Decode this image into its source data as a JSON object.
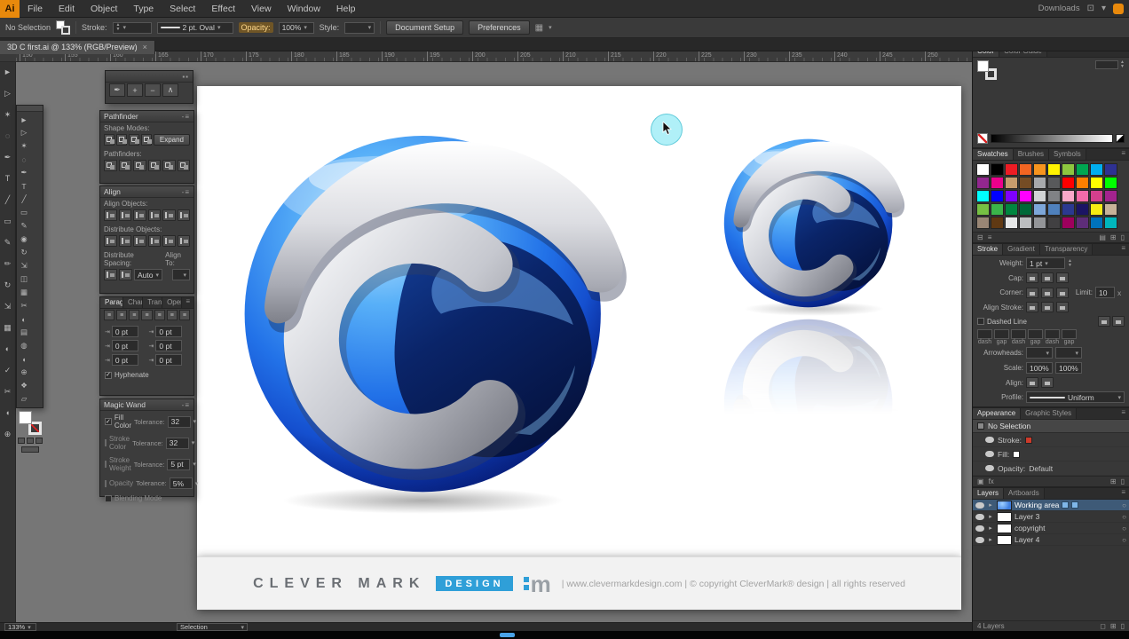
{
  "menubar": {
    "logo": "Ai",
    "items": [
      "File",
      "Edit",
      "Object",
      "Type",
      "Select",
      "Effect",
      "View",
      "Window",
      "Help"
    ],
    "right_label": "Downloads"
  },
  "controlbar": {
    "selection": "No Selection",
    "stroke_label": "Stroke:",
    "brush_value": "2 pt. Oval",
    "opacity_label": "Opacity:",
    "opacity_value": "100%",
    "style_label": "Style:",
    "document_setup": "Document Setup",
    "preferences": "Preferences"
  },
  "tab": {
    "title": "3D C first.ai @ 133% (RGB/Preview)",
    "close": "×"
  },
  "ruler": {
    "numbers": [
      "150",
      "155",
      "160",
      "165",
      "170",
      "175",
      "180",
      "185",
      "190",
      "195",
      "200",
      "205",
      "210",
      "215",
      "220",
      "225",
      "230",
      "235",
      "240",
      "245",
      "250"
    ]
  },
  "toolstrip": {
    "tools": [
      {
        "n": "selection",
        "g": "►"
      },
      {
        "n": "direct-selection",
        "g": "▷"
      },
      {
        "n": "magic-wand",
        "g": "✶"
      },
      {
        "n": "lasso",
        "g": "◌"
      },
      {
        "n": "pen",
        "g": "✒"
      },
      {
        "n": "type",
        "g": "T"
      },
      {
        "n": "line-segment",
        "g": "╱"
      },
      {
        "n": "rectangle",
        "g": "▭"
      },
      {
        "n": "paintbrush",
        "g": "✎"
      },
      {
        "n": "pencil",
        "g": "✏"
      },
      {
        "n": "rotate",
        "g": "↻"
      },
      {
        "n": "scale",
        "g": "⇲"
      },
      {
        "n": "mesh",
        "g": "▦"
      },
      {
        "n": "gradient",
        "g": "◐"
      },
      {
        "n": "eyedropper",
        "g": "✓"
      },
      {
        "n": "scissors",
        "g": "✂"
      },
      {
        "n": "hand",
        "g": "◖"
      },
      {
        "n": "zoom",
        "g": "⊕"
      }
    ]
  },
  "toolbox": {
    "tools": [
      {
        "n": "selection",
        "g": "►"
      },
      {
        "n": "direct-selection",
        "g": "▷"
      },
      {
        "n": "magic-wand",
        "g": "✶"
      },
      {
        "n": "lasso",
        "g": "◌"
      },
      {
        "n": "pen",
        "g": "✒"
      },
      {
        "n": "type",
        "g": "T"
      },
      {
        "n": "line-segment",
        "g": "╱"
      },
      {
        "n": "rectangle",
        "g": "▭"
      },
      {
        "n": "paintbrush",
        "g": "✎"
      },
      {
        "n": "blob-brush",
        "g": "◉"
      },
      {
        "n": "rotate",
        "g": "↻"
      },
      {
        "n": "scale",
        "g": "⇲"
      },
      {
        "n": "shape-builder",
        "g": "◫"
      },
      {
        "n": "mesh",
        "g": "▦"
      },
      {
        "n": "scissors",
        "g": "✂"
      },
      {
        "n": "gradient",
        "g": "◐"
      },
      {
        "n": "graph",
        "g": "▤"
      },
      {
        "n": "symbol-sprayer",
        "g": "◍"
      },
      {
        "n": "hand",
        "g": "◖"
      },
      {
        "n": "zoom",
        "g": "⊕"
      },
      {
        "n": "perspective-grid",
        "g": "❖"
      },
      {
        "n": "artboard",
        "g": "▱"
      }
    ]
  },
  "panels": {
    "tools_mini": {
      "icons": [
        {
          "n": "pen",
          "g": "✒"
        },
        {
          "n": "add-anchor",
          "g": "+"
        },
        {
          "n": "delete-anchor",
          "g": "−"
        },
        {
          "n": "convert-anchor",
          "g": "∧"
        }
      ]
    },
    "pathfinder": {
      "title": "Pathfinder",
      "shape_modes_label": "Shape Modes:",
      "shape_modes": [
        "unite",
        "minus-front",
        "intersect",
        "exclude"
      ],
      "expand_button": "Expand",
      "pathfinders_label": "Pathfinders:",
      "pathfinders": [
        "divide",
        "trim",
        "merge",
        "crop",
        "outline",
        "minus-back"
      ]
    },
    "align": {
      "title": "Align",
      "align_objects_label": "Align Objects:",
      "align_objects": [
        "horizontal-left",
        "horizontal-center",
        "horizontal-right",
        "vertical-top",
        "vertical-center",
        "vertical-bottom"
      ],
      "distribute_objects_label": "Distribute Objects:",
      "distribute_objects": [
        "vertical-top",
        "vertical-center",
        "vertical-bottom",
        "horizontal-left",
        "horizontal-center",
        "horizontal-right"
      ],
      "distribute_spacing_label": "Distribute Spacing:",
      "spacing_value": "Auto",
      "align_to_label": "Align To:"
    },
    "paragraph": {
      "tabs": [
        "Paragraph",
        "Charact",
        "Transfo",
        "OpenTy"
      ],
      "align_buttons": [
        "align-left",
        "align-center",
        "align-right",
        "justify-last-left",
        "justify-last-center",
        "justify-last-right",
        "justify-all"
      ],
      "fields": [
        "0 pt",
        "0 pt",
        "0 pt",
        "0 pt",
        "0 pt",
        "0 pt"
      ],
      "hyphenate_label": "Hyphenate"
    },
    "magic_wand": {
      "title": "Magic Wand",
      "rows": [
        {
          "label": "Fill Color",
          "checked": true,
          "tol_label": "Tolerance:",
          "value": "32"
        },
        {
          "label": "Stroke Color",
          "checked": false,
          "tol_label": "Tolerance:",
          "value": "32"
        },
        {
          "label": "Stroke Weight",
          "checked": false,
          "tol_label": "Tolerance:",
          "value": "5 pt"
        },
        {
          "label": "Opacity",
          "checked": false,
          "tol_label": "Tolerance:",
          "value": "5%"
        },
        {
          "label": "Blending Mode",
          "checked": false,
          "tol_label": "",
          "value": ""
        }
      ]
    }
  },
  "dock": {
    "color": {
      "tabs": [
        "Color",
        "Color Guide"
      ]
    },
    "swatches": {
      "tabs": [
        "Swatches",
        "Brushes",
        "Symbols"
      ],
      "colors": [
        "#ffffff",
        "#000000",
        "#ed1c24",
        "#f26522",
        "#f7941e",
        "#fff200",
        "#8dc63f",
        "#00a651",
        "#00aeef",
        "#2e3192",
        "#92278f",
        "#ec008c",
        "#c69c6d",
        "#754c24",
        "#a7a9ac",
        "#58595b",
        "#ff0000",
        "#ff7f00",
        "#ffff00",
        "#00ff00",
        "#00ffff",
        "#0000ff",
        "#7f00ff",
        "#ff00ff",
        "#d1d3d4",
        "#808285",
        "#f9a8c9",
        "#f46ba9",
        "#d43f8d",
        "#a3238e",
        "#76c043",
        "#3ab54a",
        "#00863f",
        "#006838",
        "#7da7d9",
        "#4f81bd",
        "#2b3990",
        "#1b1464",
        "#f7ec13",
        "#c7b299",
        "#998675",
        "#603913",
        "#e6e7e8",
        "#bcbec0",
        "#939598",
        "#414042",
        "#9e005d",
        "#5e2d79",
        "#0072bc",
        "#00b7bd"
      ]
    },
    "stroke": {
      "tabs": [
        "Stroke",
        "Gradient",
        "Transparency"
      ],
      "weight_label": "Weight:",
      "weight_value": "1 pt",
      "cap_label": "Cap:",
      "corner_label": "Corner:",
      "limit_label": "Limit:",
      "limit_value": "10",
      "limit_unit": "x",
      "align_stroke_label": "Align Stroke:",
      "dashed_label": "Dashed Line",
      "dash_labels": [
        "dash",
        "gap",
        "dash",
        "gap",
        "dash",
        "gap"
      ],
      "arrowheads_label": "Arrowheads:",
      "scale_label": "Scale:",
      "scale_values": [
        "100%",
        "100%"
      ],
      "align_label": "Align:",
      "profile_label": "Profile:",
      "profile_value": "Uniform"
    },
    "appearance": {
      "tabs": [
        "Appearance",
        "Graphic Styles"
      ],
      "no_selection": "No Selection",
      "rows": [
        {
          "label": "Stroke:",
          "value": "",
          "swatch": "#cc3a2a"
        },
        {
          "label": "Fill:",
          "value": "",
          "swatch": "#ffffff"
        },
        {
          "label": "Opacity:",
          "value": "Default",
          "swatch": ""
        }
      ]
    },
    "layers": {
      "tabs": [
        "Layers",
        "Artboards"
      ],
      "items": [
        {
          "name": "Working area",
          "selected": true,
          "thumb": "#3f7fe0"
        },
        {
          "name": "Layer 3",
          "selected": false,
          "thumb": "#ffffff"
        },
        {
          "name": "copyright",
          "selected": false,
          "thumb": "#ffffff"
        },
        {
          "name": "Layer 4",
          "selected": false,
          "thumb": "#ffffff"
        }
      ],
      "count_label": "4 Layers"
    }
  },
  "artboard": {
    "footer": {
      "brand_main": "CLEVER MARK",
      "brand_badge": "DESIGN",
      "badge_color": "#2f9fd8",
      "brand_m": "m",
      "legal": "| www.clevermarkdesign.com | © copyright CleverMark® design | all rights reserved"
    }
  },
  "statusbar": {
    "zoom": "133%",
    "tool": "Selection"
  }
}
